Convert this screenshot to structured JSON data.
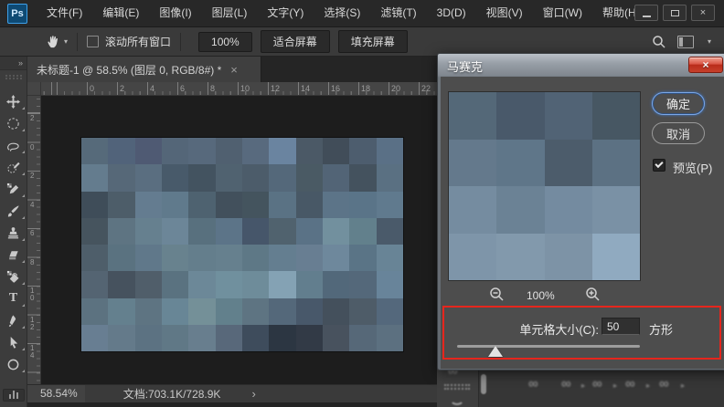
{
  "menu_bar": {
    "logo": "Ps",
    "items": [
      "文件(F)",
      "编辑(E)",
      "图像(I)",
      "图层(L)",
      "文字(Y)",
      "选择(S)",
      "滤镜(T)",
      "3D(D)",
      "视图(V)",
      "窗口(W)",
      "帮助(H)"
    ],
    "window_controls": {
      "close_glyph": "×"
    }
  },
  "options_bar": {
    "tool_icon": "hand-tool-icon",
    "dropdown_glyph": "▾",
    "scroll_all_windows_label": "滚动所有窗口",
    "zoom_100_button": "100%",
    "fit_screen_button": "适合屏幕",
    "fill_screen_button": "填充屏幕"
  },
  "tool_panel": {
    "expand_glyph": "»",
    "tools": [
      "move-tool",
      "elliptical-marquee-tool",
      "lasso-tool",
      "quick-selection-tool",
      "eyedropper-tool",
      "brush-tool",
      "clone-stamp-tool",
      "eraser-tool",
      "paint-bucket-tool",
      "type-tool",
      "pen-tool",
      "path-selection-tool",
      "ellipse-tool"
    ],
    "type_tool_glyph": "T"
  },
  "document_tab": {
    "title": "未标题-1 @ 58.5% (图层 0, RGB/8#) *",
    "close_glyph": "×"
  },
  "rulers": {
    "horizontal": [
      "0",
      "2",
      "4",
      "6",
      "8",
      "10",
      "12",
      "14",
      "16",
      "18",
      "20",
      "22"
    ],
    "vertical": [
      "2",
      "0",
      "2",
      "4",
      "6",
      "8",
      "1\n0",
      "1\n2",
      "1\n4"
    ]
  },
  "canvas": {
    "mosaic_grid": [
      [
        "#566a7a",
        "#51637a",
        "#4f5a73",
        "#546678",
        "#57697c",
        "#506070",
        "#586a7e",
        "#6a84a0",
        "#4b5966",
        "#414d59",
        "#4d5d6e",
        "#5a7086"
      ],
      [
        "#647c8e",
        "#566878",
        "#5a6e80",
        "#485a6a",
        "#435360",
        "#506270",
        "#4c5c6a",
        "#54687a",
        "#4a5a64",
        "#526476",
        "#44525e",
        "#5a7082"
      ],
      [
        "#3f4d59",
        "#4d5d69",
        "#647c90",
        "#607a8c",
        "#4e6270",
        "#42505c",
        "#44545e",
        "#5a7284",
        "#485866",
        "#5c7488",
        "#5a7488",
        "#607a8e"
      ],
      [
        "#46545e",
        "#5e7482",
        "#66808f",
        "#6c8698",
        "#58707e",
        "#5c7488",
        "#46566a",
        "#50626e",
        "#5a7286",
        "#72909e",
        "#62808c",
        "#4a5a6a"
      ],
      [
        "#4e5e6a",
        "#5a7280",
        "#60788a",
        "#68828e",
        "#647e8c",
        "#66808e",
        "#5e7886",
        "#647e90",
        "#687e92",
        "#6e889c",
        "#5a7486",
        "#688496"
      ],
      [
        "#546472",
        "#46525e",
        "#505e6a",
        "#5a7280",
        "#6c8898",
        "#70909e",
        "#6e8c9a",
        "#84a2b4",
        "#627e8e",
        "#52687a",
        "#54687a",
        "#68849a"
      ],
      [
        "#5c7280",
        "#64808e",
        "#5e7482",
        "#688696",
        "#749098",
        "#62808c",
        "#5e7482",
        "#54687a",
        "#48586a",
        "#44505c",
        "#4e5c68",
        "#54687c"
      ],
      [
        "#687e92",
        "#647a8a",
        "#5c7282",
        "#607886",
        "#687e8e",
        "#58687a",
        "#3e4c5c",
        "#2c3642",
        "#323a46",
        "#48525e",
        "#566878",
        "#5c7080"
      ]
    ]
  },
  "status_bar": {
    "zoom_level": "58.54%",
    "document_info": "文档:703.1K/728.9K",
    "chevron_glyph": "›"
  },
  "dialog": {
    "title": "马赛克",
    "close_glyph": "×",
    "ok_button": "确定",
    "cancel_button": "取消",
    "preview_checkbox_label": "预览(P)",
    "preview_checked": true,
    "zoom_level": "100%",
    "cell_size_label": "单元格大小(C):",
    "cell_size_value": "50",
    "shape_label": "方形",
    "preview_grid": [
      [
        "#546878",
        "#49596a",
        "#516375",
        "#475763"
      ],
      [
        "#64798c",
        "#5f7689",
        "#4c5c6b",
        "#5c7183"
      ],
      [
        "#758ca0",
        "#6b8295",
        "#748ba0",
        "#7a91a5"
      ],
      [
        "#7e95a9",
        "#8299ac",
        "#7d93a6",
        "#90aac0"
      ]
    ]
  },
  "background_panel": {
    "link_glyph": "∞",
    "triangle_glyph": "▸"
  },
  "colors": {
    "highlight_red": "#e6261d",
    "focus_blue": "#7aa7e8",
    "logo_blue": "#3fa0e8",
    "dialog_bg": "#4d4d4d",
    "app_bg": "#262626"
  }
}
